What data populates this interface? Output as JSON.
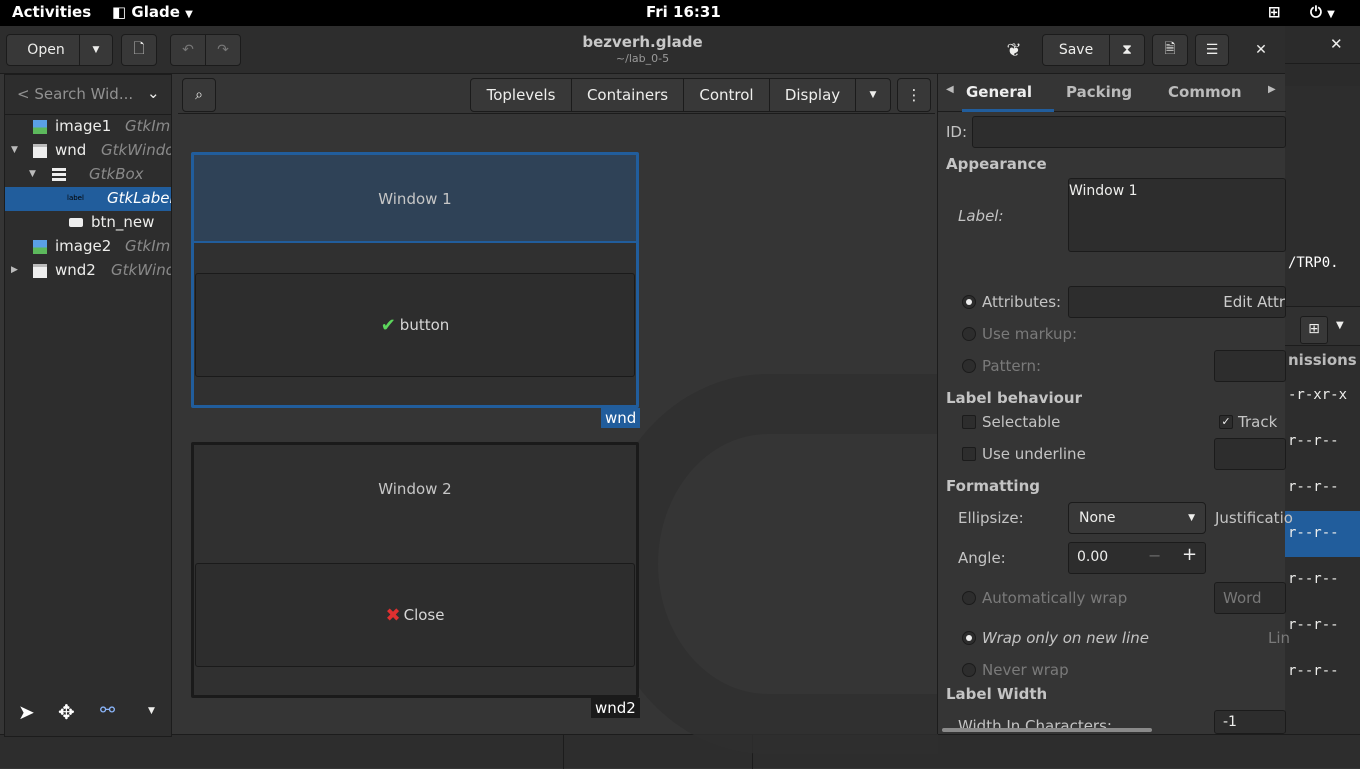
{
  "topbar": {
    "activities": "Activities",
    "app": "Glade",
    "clock": "Fri 16:31"
  },
  "header": {
    "open": "Open",
    "title": "bezverh.glade",
    "subtitle": "~/lab_0-5",
    "save": "Save"
  },
  "bgwin": {
    "text1": "/TRP0.",
    "permissions": "nissions",
    "rows": [
      "-r-xr-x",
      "r--r--",
      "r--r--",
      "r--r--",
      "r--r--",
      "r--r--",
      "r--r--"
    ]
  },
  "left": {
    "search_placeholder": "< Search Wid...",
    "tree": [
      {
        "label": "image1",
        "type": "GtkIm"
      },
      {
        "label": "wnd",
        "type": "GtkWindo"
      },
      {
        "label": "",
        "type": "GtkBox"
      },
      {
        "label": "",
        "type": "GtkLabel",
        "icon_text": "label"
      },
      {
        "label": "btn_new",
        "type": ""
      },
      {
        "label": "image2",
        "type": "GtkIm"
      },
      {
        "label": "wnd2",
        "type": "GtkWind"
      }
    ]
  },
  "center": {
    "tabs": [
      "Toplevels",
      "Containers",
      "Control",
      "Display"
    ],
    "wnd": {
      "title": "Window 1",
      "button": "button",
      "tag": "wnd"
    },
    "wnd2": {
      "title": "Window 2",
      "button": "Close",
      "tag": "wnd2"
    }
  },
  "props": {
    "tabs": [
      "General",
      "Packing",
      "Common"
    ],
    "id_label": "ID:",
    "appearance": "Appearance",
    "label_label": "Label:",
    "label_value": "Window 1",
    "attributes": "Attributes:",
    "edit_attr": "Edit Attr",
    "use_markup": "Use markup:",
    "pattern": "Pattern:",
    "label_behaviour": "Label behaviour",
    "selectable": "Selectable",
    "track": "Track",
    "use_underline": "Use underline",
    "formatting": "Formatting",
    "ellipsize": "Ellipsize:",
    "ellipsize_value": "None",
    "justification": "Justificatio",
    "angle": "Angle:",
    "angle_value": "0.00",
    "auto_wrap": "Automatically wrap",
    "word": "Word",
    "wrap_new_line": "Wrap only on new line",
    "lin": "Lin",
    "never_wrap": "Never wrap",
    "label_width": "Label Width",
    "width_chars": "Width In Characters:",
    "width_value": "-1"
  }
}
